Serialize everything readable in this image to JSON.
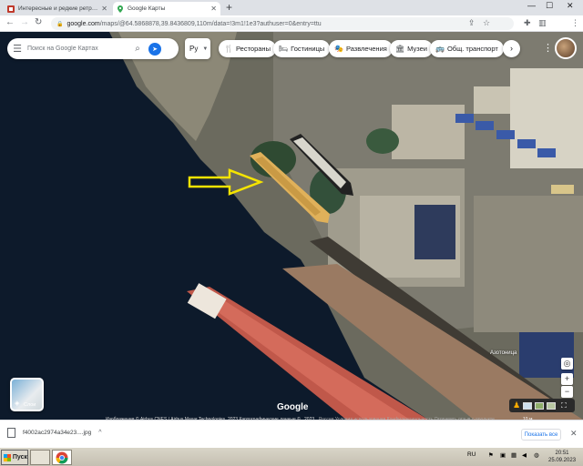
{
  "browser": {
    "tabs": [
      {
        "title": "Интересные и редкие ретро-фото",
        "active": false
      },
      {
        "title": "Google Карты",
        "active": true
      }
    ],
    "new_tab": "+",
    "window_controls": {
      "minimize": "—",
      "maximize": "☐",
      "close": "✕"
    },
    "url": {
      "host": "google.com",
      "path": "/maps/@64.5868878,39.8436809,110m/data=!3m1!1e3?authuser=0&entry=ttu"
    }
  },
  "maps": {
    "search_placeholder": "Поиск на Google Картах",
    "language_selector": "Ру",
    "chips": [
      {
        "label": "Рестораны",
        "icon": "🍴"
      },
      {
        "label": "Гостиницы",
        "icon": "🛏"
      },
      {
        "label": "Развлечения",
        "icon": "🎭"
      },
      {
        "label": "Музеи",
        "icon": "🏛"
      },
      {
        "label": "Общ. транспорт",
        "icon": "🚌"
      }
    ],
    "layers_label": "Слои",
    "google_mark": "Google",
    "attribution": "Изображения © Airbus,CNES / Airbus,Maxar Technologies, 2023,Картографические данные © , 2023",
    "attribution_extra": "Россия   Условия использования   Конфиденциальность   Отправить отзыв о продукте",
    "scale": "10 м",
    "place_label": "Азотоница",
    "zoom_in": "+",
    "zoom_out": "−",
    "colors": {
      "arrow": "#f5e400",
      "ship_red": "#c0584a",
      "water": "#0d1a2b"
    }
  },
  "download": {
    "filename": "f4002ac2974a34e23....jpg",
    "show_all": "Показать все",
    "close": "✕"
  },
  "taskbar": {
    "start": "Пуск",
    "lang": "RU",
    "time": "20:51",
    "date": "25.09.2023"
  }
}
